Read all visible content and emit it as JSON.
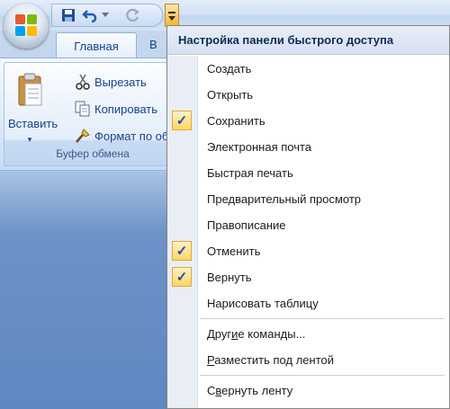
{
  "ribbon": {
    "tabs": [
      {
        "label": "Главная",
        "active": true
      },
      {
        "label": "В",
        "active": false
      }
    ],
    "clipboard_group": {
      "paste_label": "Вставить",
      "paste_arrow": "▾",
      "cut_label": "Вырезать",
      "copy_label": "Копировать",
      "format_painter_label": "Формат по образцу",
      "group_label": "Буфер обмена"
    }
  },
  "qat_menu": {
    "header": "Настройка панели быстрого доступа",
    "check_glyph": "✓",
    "items": [
      {
        "label": "Создать",
        "checked": false
      },
      {
        "label": "Открыть",
        "checked": false
      },
      {
        "label": "Сохранить",
        "checked": true
      },
      {
        "label": "Электронная почта",
        "checked": false
      },
      {
        "label": "Быстрая печать",
        "checked": false
      },
      {
        "label": "Предварительный просмотр",
        "checked": false
      },
      {
        "label": "Правописание",
        "checked": false
      },
      {
        "label": "Отменить",
        "checked": true
      },
      {
        "label": "Вернуть",
        "checked": true
      },
      {
        "label": "Нарисовать таблицу",
        "checked": false
      }
    ],
    "more_commands": {
      "pre": "Друг",
      "mnemonic": "и",
      "post": "е команды..."
    },
    "show_below_ribbon": {
      "pre": "",
      "mnemonic": "Р",
      "post": "азместить под лентой"
    },
    "minimize_ribbon": {
      "pre": "С",
      "mnemonic": "в",
      "post": "ернуть ленту"
    }
  },
  "colors": {
    "accent_check_bg": "#ffd566",
    "ribbon_text": "#15428b",
    "menu_header_text": "#0f2a58"
  }
}
